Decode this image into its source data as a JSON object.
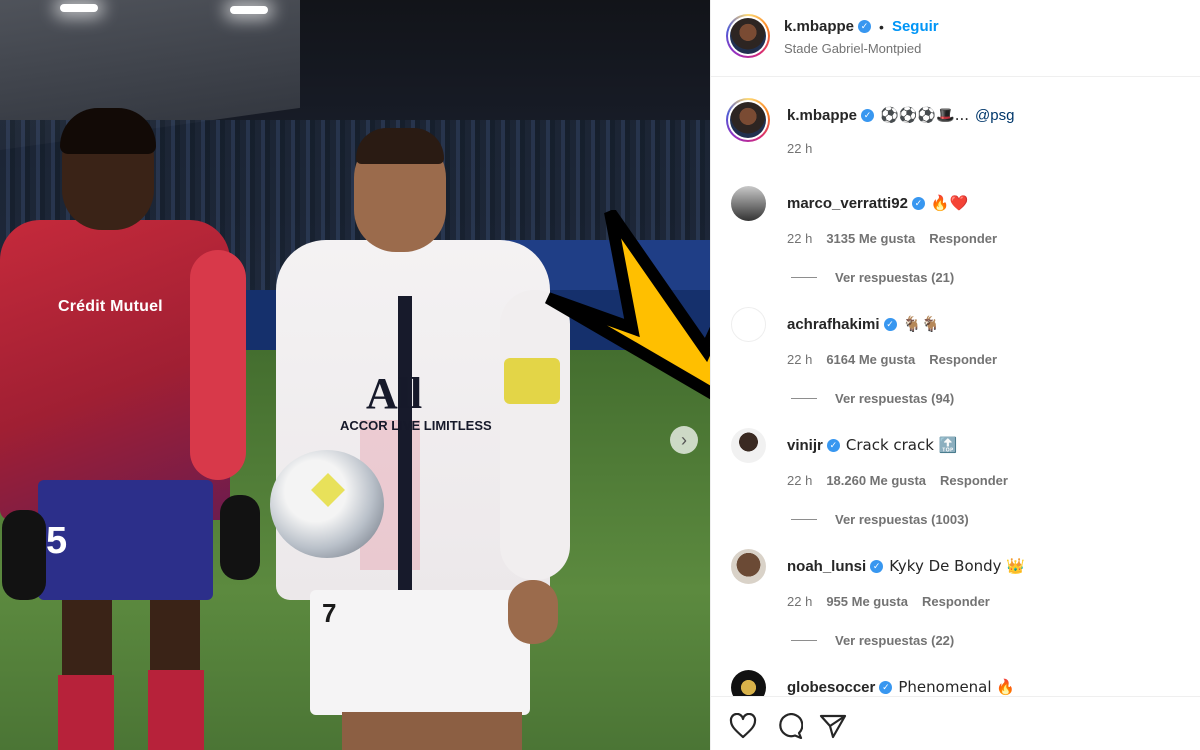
{
  "post": {
    "author": "k.mbappe",
    "follow_label": "Seguir",
    "separator": "•",
    "location": "Stade Gabriel-Montpied",
    "verified_mark": "✓"
  },
  "photo": {
    "sponsor_text": "Crédit Mutuel",
    "jersey_brand": "All",
    "jersey_sponsor": "ACCOR LIVE LIMITLESS",
    "left_player_number": "5",
    "right_player_number": "7",
    "next_icon": "chevron-right-icon",
    "arrow_color": "#ffbf00"
  },
  "caption": {
    "user": "k.mbappe",
    "emojis": "⚽⚽⚽🎩...",
    "mention": "@psg",
    "time": "22 h"
  },
  "comments": [
    {
      "user": "marco_verratti92",
      "text": "🔥❤️",
      "time": "22 h",
      "likes": "3135 Me gusta",
      "reply": "Responder",
      "replies": "Ver respuestas (21)"
    },
    {
      "user": "achrafhakimi",
      "text": "🐐🐐",
      "time": "22 h",
      "likes": "6164 Me gusta",
      "reply": "Responder",
      "replies": "Ver respuestas (94)"
    },
    {
      "user": "vinijr",
      "text": "Crack crack 🔝",
      "time": "22 h",
      "likes": "18.260 Me gusta",
      "reply": "Responder",
      "replies": "Ver respuestas (1003)"
    },
    {
      "user": "noah_lunsi",
      "text": "Kyky De Bondy 👑",
      "time": "22 h",
      "likes": "955 Me gusta",
      "reply": "Responder",
      "replies": "Ver respuestas (22)"
    },
    {
      "user": "globesoccer",
      "text": "Phenomenal 🔥"
    }
  ],
  "actions": {
    "like_icon": "heart-icon",
    "comment_icon": "comment-icon",
    "share_icon": "share-icon"
  },
  "colors": {
    "accent": "#0095f6",
    "verified": "#3897f0",
    "muted": "#737373"
  }
}
